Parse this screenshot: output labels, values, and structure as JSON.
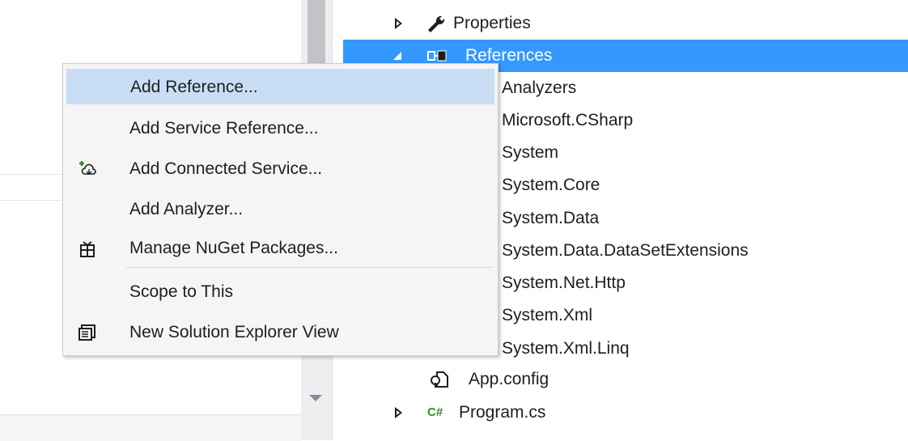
{
  "tree": {
    "items": [
      {
        "label": "Properties"
      },
      {
        "label": "References"
      },
      {
        "label": "Analyzers"
      },
      {
        "label": "Microsoft.CSharp"
      },
      {
        "label": "System"
      },
      {
        "label": "System.Core"
      },
      {
        "label": "System.Data"
      },
      {
        "label": "System.Data.DataSetExtensions"
      },
      {
        "label": "System.Net.Http"
      },
      {
        "label": "System.Xml"
      },
      {
        "label": "System.Xml.Linq"
      },
      {
        "label": "App.config"
      },
      {
        "label": "Program.cs"
      }
    ],
    "csharp_badge": "C#"
  },
  "context_menu": {
    "items": [
      {
        "label": "Add Reference..."
      },
      {
        "label": "Add Service Reference..."
      },
      {
        "label": "Add Connected Service..."
      },
      {
        "label": "Add Analyzer..."
      },
      {
        "label": "Manage NuGet Packages..."
      },
      {
        "label": "Scope to This"
      },
      {
        "label": "New Solution Explorer View"
      }
    ]
  },
  "colors": {
    "selection": "#3399ff",
    "menu_hover": "#c9def5",
    "menu_bg": "#f5f5f5"
  }
}
